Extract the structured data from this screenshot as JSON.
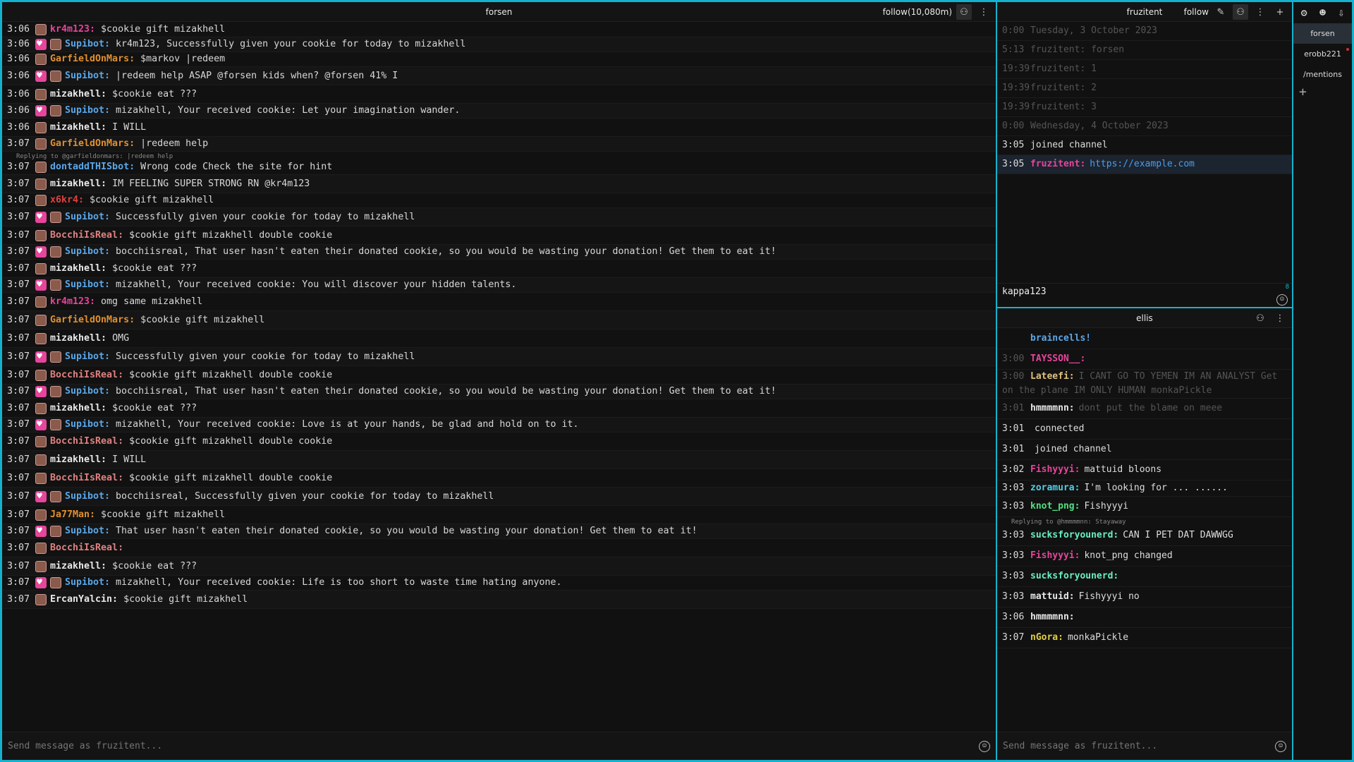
{
  "left": {
    "channel": "forsen",
    "follow_label": "follow(10,080m)",
    "input_placeholder": "Send message as fruzitent...",
    "messages": [
      {
        "ts": "3:06",
        "user": "kr4m123:",
        "color": "#e6459b",
        "text": "$cookie gift mizakhell"
      },
      {
        "ts": "3:06",
        "user": "Supibot:",
        "color": "#5aa7e8",
        "text": "kr4m123, Successfully given your cookie for today to mizakhell"
      },
      {
        "ts": "3:06",
        "user": "GarfieldOnMars:",
        "color": "#e09030",
        "text": "$markov |redeem"
      },
      {
        "ts": "3:06",
        "user": "Supibot:",
        "color": "#5aa7e8",
        "text": "|redeem help ASAP @forsen kids when? @forsen 41% I"
      },
      {
        "ts": "3:06",
        "user": "mizakhell:",
        "color": "#e8e8e8",
        "text": "$cookie eat ???"
      },
      {
        "ts": "3:06",
        "user": "Supibot:",
        "color": "#5aa7e8",
        "text": "mizakhell, Your received cookie: Let your imagination wander."
      },
      {
        "ts": "3:06",
        "user": "mizakhell:",
        "color": "#e8e8e8",
        "text": "I WILL"
      },
      {
        "ts": "3:07",
        "user": "GarfieldOnMars:",
        "color": "#e09030",
        "text": "|redeem help"
      },
      {
        "ts": "3:07",
        "user": "dontaddTHISbot:",
        "color": "#5aa7e8",
        "text": "Wrong code Check the site for hint",
        "reply": "Replying to @garfieldonmars: |redeem help"
      },
      {
        "ts": "3:07",
        "user": "mizakhell:",
        "color": "#e8e8e8",
        "text": "IM FEELING SUPER STRONG RN @kr4m123"
      },
      {
        "ts": "3:07",
        "user": "x6kr4:",
        "color": "#e04040",
        "text": "$cookie gift mizakhell"
      },
      {
        "ts": "3:07",
        "user": "Supibot:",
        "color": "#5aa7e8",
        "text": "Successfully given your cookie for today to mizakhell"
      },
      {
        "ts": "3:07",
        "user": "BocchiIsReal:",
        "color": "#e08080",
        "text": "$cookie gift mizakhell double cookie"
      },
      {
        "ts": "3:07",
        "user": "Supibot:",
        "color": "#5aa7e8",
        "text": "bocchiisreal, That user hasn't eaten their donated cookie, so you would be wasting your donation! Get them to eat it!"
      },
      {
        "ts": "3:07",
        "user": "mizakhell:",
        "color": "#e8e8e8",
        "text": "$cookie eat ???"
      },
      {
        "ts": "3:07",
        "user": "Supibot:",
        "color": "#5aa7e8",
        "text": "mizakhell, Your received cookie: You will discover your hidden talents."
      },
      {
        "ts": "3:07",
        "user": "kr4m123:",
        "color": "#e6459b",
        "text": "omg same mizakhell"
      },
      {
        "ts": "3:07",
        "user": "GarfieldOnMars:",
        "color": "#e09030",
        "text": "$cookie gift mizakhell"
      },
      {
        "ts": "3:07",
        "user": "mizakhell:",
        "color": "#e8e8e8",
        "text": "OMG"
      },
      {
        "ts": "3:07",
        "user": "Supibot:",
        "color": "#5aa7e8",
        "text": "Successfully given your cookie for today to mizakhell"
      },
      {
        "ts": "3:07",
        "user": "BocchiIsReal:",
        "color": "#e08080",
        "text": "$cookie gift mizakhell double cookie"
      },
      {
        "ts": "3:07",
        "user": "Supibot:",
        "color": "#5aa7e8",
        "text": "bocchiisreal, That user hasn't eaten their donated cookie, so you would be wasting your donation! Get them to eat it!"
      },
      {
        "ts": "3:07",
        "user": "mizakhell:",
        "color": "#e8e8e8",
        "text": "$cookie eat ???"
      },
      {
        "ts": "3:07",
        "user": "Supibot:",
        "color": "#5aa7e8",
        "text": "mizakhell, Your received cookie: Love is at your hands, be glad and hold on to it."
      },
      {
        "ts": "3:07",
        "user": "BocchiIsReal:",
        "color": "#e08080",
        "text": "$cookie gift mizakhell double cookie"
      },
      {
        "ts": "3:07",
        "user": "mizakhell:",
        "color": "#e8e8e8",
        "text": "I WILL"
      },
      {
        "ts": "3:07",
        "user": "BocchiIsReal:",
        "color": "#e08080",
        "text": "$cookie gift mizakhell double cookie"
      },
      {
        "ts": "3:07",
        "user": "Supibot:",
        "color": "#5aa7e8",
        "text": "bocchiisreal, Successfully given your cookie for today to mizakhell"
      },
      {
        "ts": "3:07",
        "user": "Ja77Man:",
        "color": "#e09030",
        "text": "$cookie gift mizakhell"
      },
      {
        "ts": "3:07",
        "user": "Supibot:",
        "color": "#5aa7e8",
        "text": "That user hasn't eaten their donated cookie, so you would be wasting your donation! Get them to eat it!"
      },
      {
        "ts": "3:07",
        "user": "BocchiIsReal:",
        "color": "#e08080",
        "text": ""
      },
      {
        "ts": "3:07",
        "user": "mizakhell:",
        "color": "#e8e8e8",
        "text": "$cookie eat ???"
      },
      {
        "ts": "3:07",
        "user": "Supibot:",
        "color": "#5aa7e8",
        "text": "mizakhell, Your received cookie: Life is too short to waste time hating anyone."
      },
      {
        "ts": "3:07",
        "user": "ErcanYalcin:",
        "color": "#e8e8e8",
        "text": "$cookie gift mizakhell"
      }
    ]
  },
  "fruz": {
    "channel": "fruzitent",
    "follow_label": "follow",
    "compose_text": "kappa123",
    "compose_count": "8",
    "lines": [
      {
        "ts": "0:00",
        "text": "Tuesday, 3 October 2023",
        "kind": "dim"
      },
      {
        "ts": "5:13",
        "text": "fruzitent: forsen",
        "kind": "dim"
      },
      {
        "ts": "19:39",
        "text": "fruzitent: 1",
        "kind": "dim"
      },
      {
        "ts": "19:39",
        "text": "fruzitent: 2",
        "kind": "dim"
      },
      {
        "ts": "19:39",
        "text": "fruzitent: 3",
        "kind": "dim"
      },
      {
        "ts": "0:00",
        "text": "Wednesday, 4 October 2023",
        "kind": "dim"
      },
      {
        "ts": "3:05",
        "text": "joined channel",
        "kind": "active"
      },
      {
        "ts": "3:05",
        "text": "fruzitent:",
        "link": "https://example.com",
        "kind": "highlight"
      }
    ]
  },
  "ellis": {
    "channel": "ellis",
    "input_placeholder": "Send message as fruzitent...",
    "lines": [
      {
        "ts": "",
        "user": "braincells!",
        "text": "",
        "kind": "dim"
      },
      {
        "ts": "3:00",
        "user": "TAYSSON__:",
        "text": "",
        "kind": "dim"
      },
      {
        "ts": "3:00",
        "user": "Lateefi:",
        "text": "I CANT GO TO YEMEN IM AN ANALYST Get on the plane IM ONLY HUMAN monkaPickle",
        "kind": "dim"
      },
      {
        "ts": "3:01",
        "user": "hmmmmnn:",
        "text": "dont put the blame on meee",
        "kind": "dim"
      },
      {
        "ts": "3:01",
        "user": "",
        "text": "connected",
        "kind": "active"
      },
      {
        "ts": "3:01",
        "user": "",
        "text": "joined channel",
        "kind": "active"
      },
      {
        "ts": "3:02",
        "user": "Fishyyyi:",
        "text": "mattuid bloons",
        "kind": "active"
      },
      {
        "ts": "3:03",
        "user": "zoramura:",
        "text": "I'm looking for ... ......",
        "kind": "active"
      },
      {
        "ts": "3:03",
        "user": "knot_png:",
        "text": "Fishyyyi",
        "kind": "active"
      },
      {
        "ts": "3:03",
        "user": "sucksforyounerd:",
        "text": "CAN I PET DAT DAWWGG",
        "kind": "active",
        "reply": "Replying to @hmmmmnn: Stayaway"
      },
      {
        "ts": "3:03",
        "user": "Fishyyyi:",
        "text": "knot_png changed",
        "kind": "active"
      },
      {
        "ts": "3:03",
        "user": "sucksforyounerd:",
        "text": "",
        "kind": "active"
      },
      {
        "ts": "3:03",
        "user": "mattuid:",
        "text": "Fishyyyi no",
        "kind": "active"
      },
      {
        "ts": "3:06",
        "user": "hmmmmnn:",
        "text": "",
        "kind": "active"
      },
      {
        "ts": "3:07",
        "user": "nGora:",
        "text": "monkaPickle",
        "kind": "active"
      }
    ]
  },
  "tabs": {
    "items": [
      "forsen",
      "erobb221",
      "/mentions"
    ]
  }
}
